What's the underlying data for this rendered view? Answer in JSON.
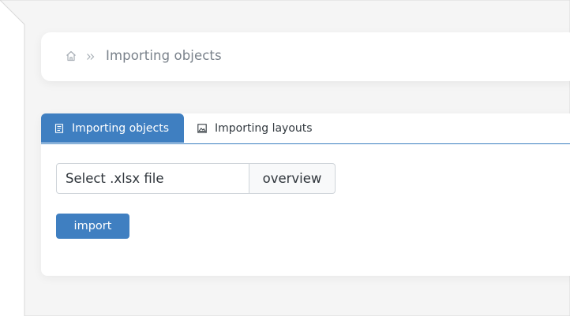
{
  "breadcrumb": {
    "home_icon": "home-icon",
    "separator_icon": "double-chevron-right-icon",
    "current": "Importing objects"
  },
  "tabs": [
    {
      "label": "Importing objects",
      "icon": "document-icon",
      "active": true
    },
    {
      "label": "Importing layouts",
      "icon": "image-icon",
      "active": false
    }
  ],
  "file_input": {
    "placeholder": "Select .xlsx file",
    "button_label": "overview"
  },
  "import_button": {
    "label": "import"
  },
  "colors": {
    "accent": "#3f7fc1",
    "page_background": "#f5f5f5",
    "card_background": "#ffffff"
  }
}
